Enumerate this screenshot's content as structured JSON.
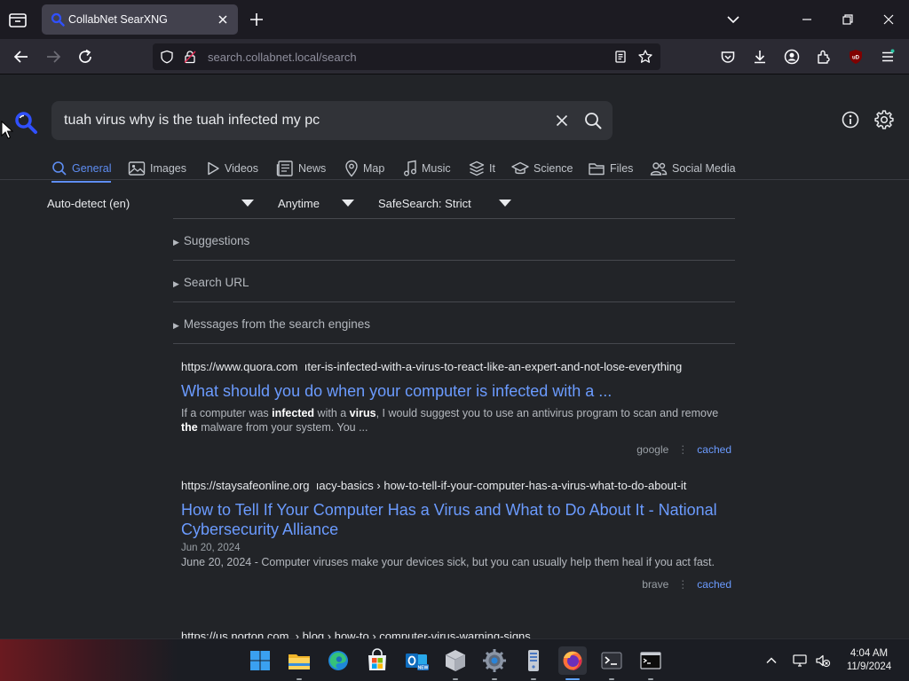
{
  "browser": {
    "tab_title": "CollabNet SearXNG",
    "url_host": "search.collabnet.local",
    "url_path": "/search"
  },
  "search": {
    "query": "tuah virus why is the tuah infected my pc"
  },
  "categories": [
    {
      "label": "General",
      "icon": "search-icon",
      "active": true
    },
    {
      "label": "Images",
      "icon": "image-icon"
    },
    {
      "label": "Videos",
      "icon": "play-icon"
    },
    {
      "label": "News",
      "icon": "newspaper-icon"
    },
    {
      "label": "Map",
      "icon": "map-pin-icon"
    },
    {
      "label": "Music",
      "icon": "music-note-icon"
    },
    {
      "label": "It",
      "icon": "layers-icon"
    },
    {
      "label": "Science",
      "icon": "graduation-cap-icon"
    },
    {
      "label": "Files",
      "icon": "files-icon"
    },
    {
      "label": "Social Media",
      "icon": "people-icon"
    }
  ],
  "filters": {
    "language": "Auto-detect (en)",
    "time_range": "Anytime",
    "safesearch": "SafeSearch: Strict"
  },
  "details": {
    "suggestions": "Suggestions",
    "search_url": "Search URL",
    "engine_messages": "Messages from the search engines"
  },
  "results": [
    {
      "url_base": "https://www.quora.com",
      "url_path": "ıter-is-infected-with-a-virus-to-react-like-an-expert-and-not-lose-everything",
      "title": "What should you do when your computer is infected with a ...",
      "content_html": "If a computer was <b>infected</b> with a <b>virus</b>, I would suggest you to use an antivirus program to scan and remove <b>the</b> malware from your system. You ...",
      "engine": "google",
      "cached": "cached"
    },
    {
      "url_base": "https://staysafeonline.org",
      "url_path": "ıacy-basics › how-to-tell-if-your-computer-has-a-virus-what-to-do-about-it",
      "title": "How to Tell If Your Computer Has a Virus and What to Do About It - National Cybersecurity Alliance",
      "date": "Jun 20, 2024",
      "content_html": "June 20, 2024 - Computer viruses make your devices sick, but you can usually help them heal if you act fast.",
      "engine": "brave",
      "cached": "cached"
    },
    {
      "url_base": "https://us.norton.com",
      "url_path": "› blog › how-to › computer-virus-warning-signs"
    }
  ],
  "taskbar": {
    "apps": [
      "windows-start-icon",
      "file-explorer-icon",
      "edge-icon",
      "store-icon",
      "outlook-icon",
      "box-app-icon",
      "settings-icon",
      "server-app-icon",
      "firefox-icon",
      "terminal-icon",
      "command-prompt-icon"
    ],
    "time": "4:04 AM",
    "date": "11/9/2024"
  },
  "colors": {
    "accent": "#5e8df2",
    "link": "#6b9bff",
    "background": "#222428"
  }
}
